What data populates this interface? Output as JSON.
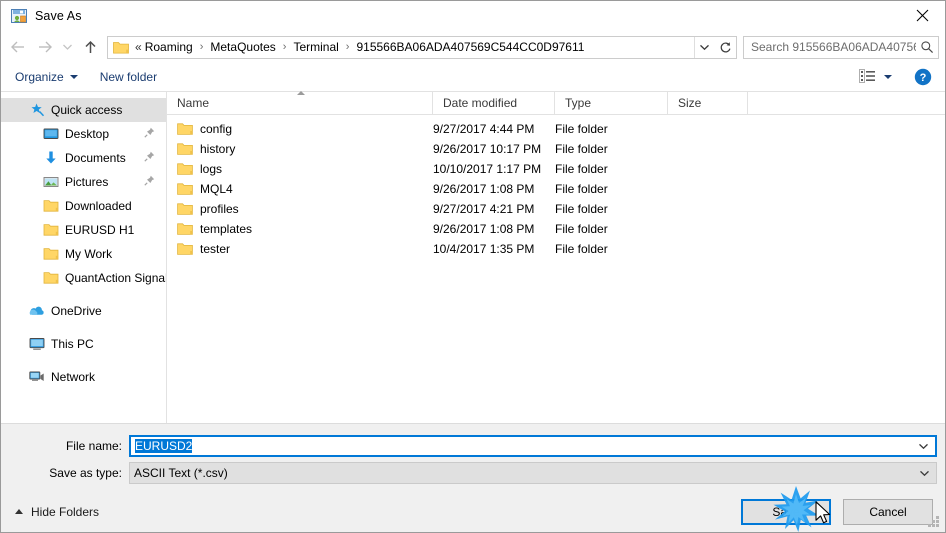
{
  "window": {
    "title": "Save As",
    "title_icon": "save-as-icon",
    "close_icon": "close-icon"
  },
  "nav": {
    "back_icon": "arrow-left-icon",
    "forward_icon": "arrow-right-icon",
    "recent_icon": "chevron-down-icon",
    "up_icon": "arrow-up-icon",
    "folder_icon": "folder-icon",
    "overflow": "«",
    "crumbs": [
      "Roaming",
      "MetaQuotes",
      "Terminal",
      "915566BA06ADA407569C544CC0D97611"
    ],
    "separator": "›",
    "dropdown_icon": "chevron-down-icon",
    "refresh_icon": "refresh-icon"
  },
  "search": {
    "placeholder": "Search 915566BA06ADA40756...",
    "icon": "search-icon"
  },
  "toolbar": {
    "organize": "Organize",
    "new_folder": "New folder",
    "view_icon": "view-list-icon",
    "view_caret_icon": "chevron-down-icon",
    "help_icon": "help-icon"
  },
  "sidebar": {
    "items": [
      {
        "label": "Quick access",
        "icon": "star-pin-icon",
        "selected": true,
        "indent": 0,
        "pinned": false
      },
      {
        "label": "Desktop",
        "icon": "desktop-icon",
        "selected": false,
        "indent": 1,
        "pinned": true
      },
      {
        "label": "Documents",
        "icon": "documents-icon",
        "selected": false,
        "indent": 1,
        "pinned": true
      },
      {
        "label": "Pictures",
        "icon": "pictures-icon",
        "selected": false,
        "indent": 1,
        "pinned": true
      },
      {
        "label": "Downloaded",
        "icon": "folder-icon",
        "selected": false,
        "indent": 1,
        "pinned": false
      },
      {
        "label": "EURUSD H1",
        "icon": "folder-icon",
        "selected": false,
        "indent": 1,
        "pinned": false
      },
      {
        "label": "My Work",
        "icon": "folder-icon",
        "selected": false,
        "indent": 1,
        "pinned": false
      },
      {
        "label": "QuantAction Signal",
        "icon": "folder-icon",
        "selected": false,
        "indent": 1,
        "pinned": false
      },
      {
        "label": "OneDrive",
        "icon": "onedrive-icon",
        "selected": false,
        "indent": 0,
        "pinned": false,
        "gap_before": true
      },
      {
        "label": "This PC",
        "icon": "this-pc-icon",
        "selected": false,
        "indent": 0,
        "pinned": false,
        "gap_before": true
      },
      {
        "label": "Network",
        "icon": "network-icon",
        "selected": false,
        "indent": 0,
        "pinned": false,
        "gap_before": true
      }
    ]
  },
  "filelist": {
    "columns": [
      "Name",
      "Date modified",
      "Type",
      "Size"
    ],
    "sort_column": "Name",
    "sort_direction": "ascending",
    "rows": [
      {
        "name": "config",
        "date": "9/27/2017 4:44 PM",
        "type": "File folder",
        "size": ""
      },
      {
        "name": "history",
        "date": "9/26/2017 10:17 PM",
        "type": "File folder",
        "size": ""
      },
      {
        "name": "logs",
        "date": "10/10/2017 1:17 PM",
        "type": "File folder",
        "size": ""
      },
      {
        "name": "MQL4",
        "date": "9/26/2017 1:08 PM",
        "type": "File folder",
        "size": ""
      },
      {
        "name": "profiles",
        "date": "9/27/2017 4:21 PM",
        "type": "File folder",
        "size": ""
      },
      {
        "name": "templates",
        "date": "9/26/2017 1:08 PM",
        "type": "File folder",
        "size": ""
      },
      {
        "name": "tester",
        "date": "10/4/2017 1:35 PM",
        "type": "File folder",
        "size": ""
      }
    ]
  },
  "form": {
    "file_name_label": "File name:",
    "file_name_value": "EURUSD2",
    "file_name_selected": true,
    "save_as_type_label": "Save as type:",
    "save_as_type_value": "ASCII Text (*.csv)",
    "dropdown_icon": "chevron-down-icon"
  },
  "footer": {
    "hide_folders": "Hide Folders",
    "hide_folders_icon": "chevron-up-icon",
    "save_label": "Save",
    "cancel_label": "Cancel",
    "resize_grip_icon": "resize-grip-icon"
  },
  "cursor": {
    "click_effect_icon": "click-burst-icon",
    "pointer_icon": "mouse-pointer-icon"
  },
  "colors": {
    "accent": "#0078d7",
    "folder": "#ffd666",
    "panel": "#f0f0f0",
    "selected_row": "#e0e0e0",
    "link_text": "#1a3c70"
  }
}
